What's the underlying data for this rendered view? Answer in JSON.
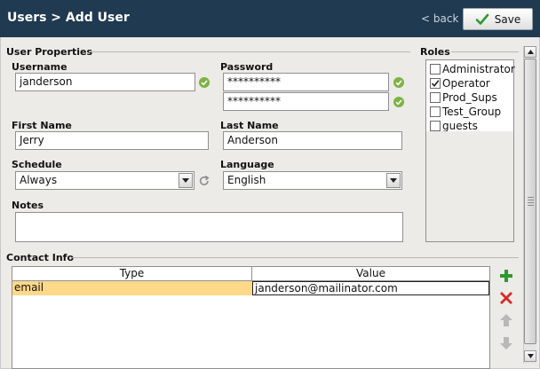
{
  "header": {
    "title": "Users > Add User",
    "back_label": "< back",
    "save_label": "Save",
    "colors": {
      "bar": "#1f3a51",
      "save_check": "#2e9a2e"
    }
  },
  "user_properties": {
    "section_label": "User Properties",
    "username": {
      "label": "Username",
      "value": "janderson"
    },
    "password": {
      "label": "Password",
      "value": "**********",
      "confirm_value": "**********"
    },
    "first_name": {
      "label": "First Name",
      "value": "Jerry"
    },
    "last_name": {
      "label": "Last Name",
      "value": "Anderson"
    },
    "schedule": {
      "label": "Schedule",
      "value": "Always"
    },
    "language": {
      "label": "Language",
      "value": "English"
    },
    "notes": {
      "label": "Notes",
      "value": ""
    },
    "valid_icon_color": "#7cb342"
  },
  "roles": {
    "section_label": "Roles",
    "items": [
      {
        "label": "Administrator",
        "checked": false
      },
      {
        "label": "Operator",
        "checked": true
      },
      {
        "label": "Prod_Sups",
        "checked": false
      },
      {
        "label": "Test_Group",
        "checked": false
      },
      {
        "label": "guests",
        "checked": false
      }
    ]
  },
  "contact_info": {
    "section_label": "Contact Info",
    "columns": [
      "Type",
      "Value"
    ],
    "rows": [
      {
        "type": "email",
        "value": "janderson@mailinator.com",
        "selected": true
      }
    ],
    "selected_row_color": "#ffd98a"
  }
}
